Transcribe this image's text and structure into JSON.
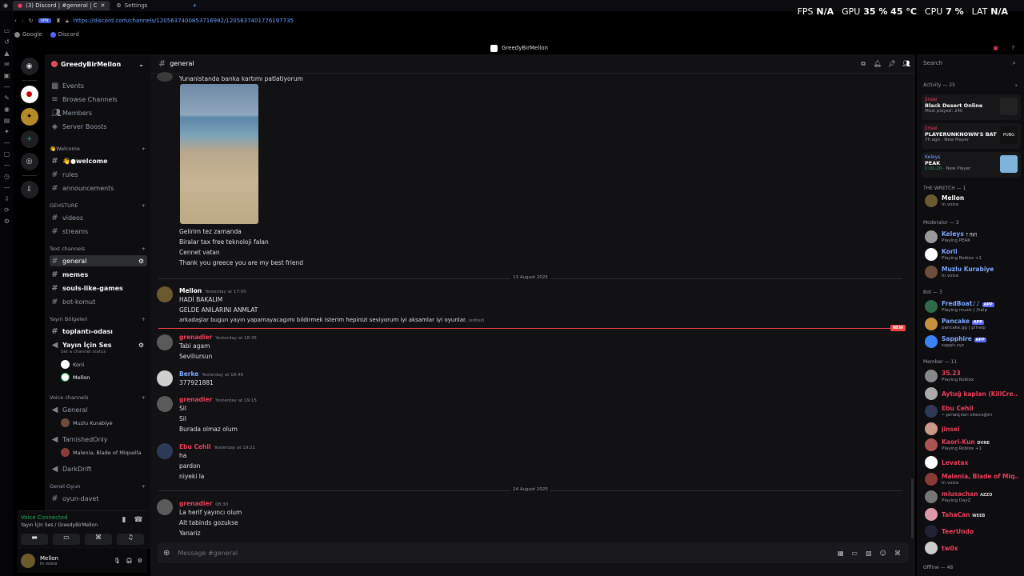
{
  "browser": {
    "tabs": [
      {
        "label": "(3) Discord | #general | C"
      },
      {
        "label": "Settings"
      }
    ],
    "new_tab": "+",
    "url": "https://discord.com/channels/1205637400853716992/1205637401776197735",
    "bookmarks": [
      "Google",
      "Discord"
    ]
  },
  "hud": {
    "fps_label": "FPS",
    "fps_value": "N/A",
    "gpu_label": "GPU",
    "gpu_value": "35 % 45 °C",
    "cpu_label": "CPU",
    "cpu_value": "7 %",
    "lat_label": "LAT",
    "lat_value": "N/A"
  },
  "window_title": "GreedyBirMellon",
  "server": {
    "name": "GreedyBirMellon",
    "top_items": [
      "Events",
      "Browse Channels",
      "Members",
      "Server Boosts"
    ],
    "categories": {
      "welcome": "👋Welcome",
      "gehsture": "GEHSTURE",
      "text": "Text channels",
      "yayin": "Yayın Bölgeleri",
      "voice": "Voice channels",
      "genel": "Genel Oyun"
    },
    "channels": {
      "welcome": "👋●welcome",
      "rules": "rules",
      "announcements": "announcements",
      "videos": "videos",
      "streams": "streams",
      "general": "general",
      "memes": "memes",
      "souls": "souls-like-games",
      "botkomut": "bot-komut",
      "toplanti": "toplantı-odası",
      "yayin_ses": "Yayın İçin Ses",
      "yayin_status": "Set a channel status",
      "general_voice": "General",
      "tarnished": "TarnishedOnly",
      "darkdrift": "DarkDrift",
      "oyun_davet": "oyun-davet"
    },
    "voice_users": {
      "yayin": [
        "Korii",
        "Mellon"
      ],
      "general": [
        "Muzlu Kurabiye"
      ],
      "tarnished": [
        "Malenia, Blade of Miquella"
      ]
    }
  },
  "voice": {
    "status": "Voice Connected",
    "location": "Yayın İçin Ses / GreedyBirMellon"
  },
  "user": {
    "name": "Mellon",
    "status": "In voice"
  },
  "chat": {
    "channel": "general",
    "first_line": "Yunanistanda banka kartımı patlatiyorum",
    "after_image": [
      "Gelirim tez zamanda",
      "Biralar tax free teknoloji falan",
      "Cennet vatan",
      "Thank you greece you are my best friend"
    ],
    "date1": "13 August 2025",
    "date2": "14 August 2025",
    "new_badge": "NEW",
    "edited": "(edited)",
    "messages": [
      {
        "author": "Mellon",
        "time": "Yesterday at 17:00",
        "color": "#ffffff",
        "lines": [
          "HADİ BAKALIM",
          "GELDE ANILARINI ANMLAT",
          "arkadaşlar bugun yayın yapamayacagımı bildirmek isterim hepinizi seviyorum iyi aksamlar iyi oyunlar."
        ]
      },
      {
        "author": "grenadier",
        "time": "Yesterday at 18:35",
        "color": "#ec3e5c",
        "lines": [
          "Tabi agam",
          "Seviliursun"
        ]
      },
      {
        "author": "Berke",
        "time": "Yesterday at 18:49",
        "color": "#7ea6ff",
        "lines": [
          "377921881"
        ]
      },
      {
        "author": "grenadier",
        "time": "Yesterday at 19:15",
        "color": "#ec3e5c",
        "lines": [
          "Sil",
          "Sil",
          "Burada olmaz olum"
        ]
      },
      {
        "author": "Ebu Cehil",
        "time": "Yesterday at 19:21",
        "color": "#ec3e5c",
        "lines": [
          "ha",
          "pardon",
          "niyeki la"
        ]
      },
      {
        "author": "grenadier",
        "time": "08:30",
        "color": "#ec3e5c",
        "lines": [
          "La herif yayıncı olum",
          "Alt tabinds gozukse",
          "Yanariz"
        ]
      }
    ],
    "composer_placeholder": "Message #general"
  },
  "members": {
    "search_placeholder": "Search",
    "activity_header": "Activity — 25",
    "activities": [
      {
        "user": "jinsei",
        "game": "Black Desert Online",
        "meta": "Most played: 24h"
      },
      {
        "user": "jinsei",
        "game": "PLAYERUNKNOWN'S BATT...",
        "meta": "7h ago",
        "badge": "New Player",
        "thumb": "PUBG"
      },
      {
        "user": "Keleys",
        "game": "PEAK",
        "meta": "1:01:20",
        "badge": "New Player"
      }
    ],
    "groups": [
      {
        "header": "THE WRETCH — 1",
        "items": [
          {
            "name": "Mellon",
            "status": "In voice",
            "color": "#ffffff"
          }
        ]
      },
      {
        "header": "Moderator — 3",
        "items": [
          {
            "name": "Keleys",
            "status": "Playing PEAK",
            "color": "#7ea6ff",
            "tag": "ᛉ ᛗᛒᛖ"
          },
          {
            "name": "Korii",
            "status": "Playing Roblox +1",
            "color": "#7ea6ff"
          },
          {
            "name": "Muzlu Kurabiye",
            "status": "In voice",
            "color": "#7ea6ff"
          }
        ]
      },
      {
        "header": "Bot — 3",
        "items": [
          {
            "name": "FredBoat♪♪",
            "status": "Playing music | /help",
            "color": "#7ea6ff",
            "app": "APP"
          },
          {
            "name": "Pancake",
            "status": "pancake.gg | p!help",
            "color": "#7ea6ff",
            "app": "APP"
          },
          {
            "name": "Sapphire",
            "status": "sapph.xyz",
            "color": "#7ea6ff",
            "app": "APP"
          }
        ]
      },
      {
        "header": "Member — 11",
        "items": [
          {
            "name": "35.23",
            "status": "Playing Roblox",
            "color": "#ec3e5c"
          },
          {
            "name": "Aytuğ kaplan (KillCre...",
            "status": "",
            "color": "#ec3e5c"
          },
          {
            "name": "Ebu Cehil",
            "status": "• şeriatçıları sikeceğim",
            "color": "#ec3e5c"
          },
          {
            "name": "jinsei",
            "status": "",
            "color": "#ec3e5c"
          },
          {
            "name": "Kaori-Kun",
            "status": "Playing Roblox +1",
            "color": "#ec3e5c",
            "tag": "DVNE"
          },
          {
            "name": "Levatax",
            "status": "",
            "color": "#ec3e5c"
          },
          {
            "name": "Malenia, Blade of Miq...",
            "status": "In voice",
            "color": "#ec3e5c"
          },
          {
            "name": "miusachan",
            "status": "Playing DayZ",
            "color": "#ec3e5c",
            "tag": "AZZO"
          },
          {
            "name": "TahaCan",
            "status": "",
            "color": "#ec3e5c",
            "tag": "WEEB"
          },
          {
            "name": "TeerUndo",
            "status": "",
            "color": "#ec3e5c"
          },
          {
            "name": "tw0x",
            "status": "",
            "color": "#ec3e5c"
          }
        ]
      }
    ],
    "offline": "Offline — 48"
  }
}
